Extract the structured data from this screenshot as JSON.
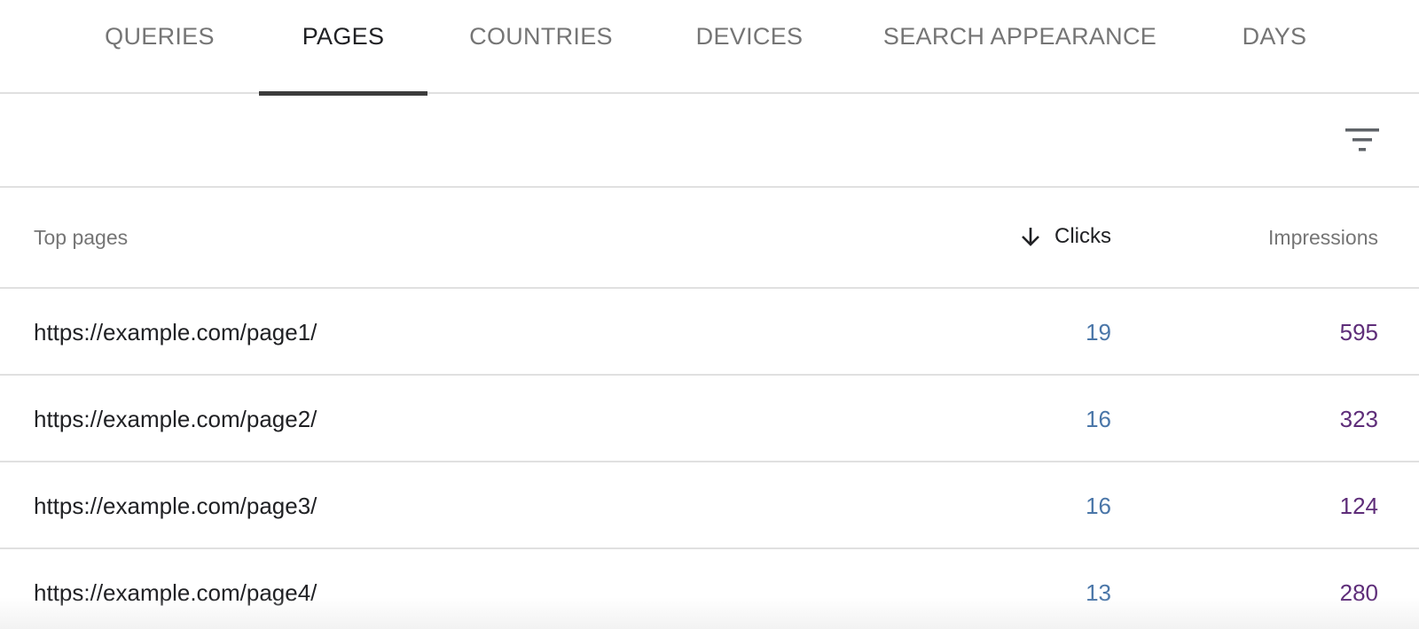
{
  "tabs": [
    {
      "label": "QUERIES",
      "active": false
    },
    {
      "label": "PAGES",
      "active": true
    },
    {
      "label": "COUNTRIES",
      "active": false
    },
    {
      "label": "DEVICES",
      "active": false
    },
    {
      "label": "SEARCH APPEARANCE",
      "active": false
    },
    {
      "label": "DAYS",
      "active": false
    }
  ],
  "toolbar": {
    "filter_icon": "filter-icon"
  },
  "table": {
    "headers": {
      "pages": "Top pages",
      "clicks": "Clicks",
      "clicks_sort_icon": "arrow-down-icon",
      "impressions": "Impressions"
    },
    "rows": [
      {
        "url": "https://example.com/page1/",
        "clicks": "19",
        "impressions": "595"
      },
      {
        "url": "https://example.com/page2/",
        "clicks": "16",
        "impressions": "323"
      },
      {
        "url": "https://example.com/page3/",
        "clicks": "16",
        "impressions": "124"
      },
      {
        "url": "https://example.com/page4/",
        "clicks": "13",
        "impressions": "280"
      }
    ]
  },
  "colors": {
    "clicks": "#4a76a8",
    "impressions": "#5e2d79",
    "active_tab": "#202124",
    "inactive_tab": "#757575",
    "tab_indicator": "#3c3c3c"
  }
}
